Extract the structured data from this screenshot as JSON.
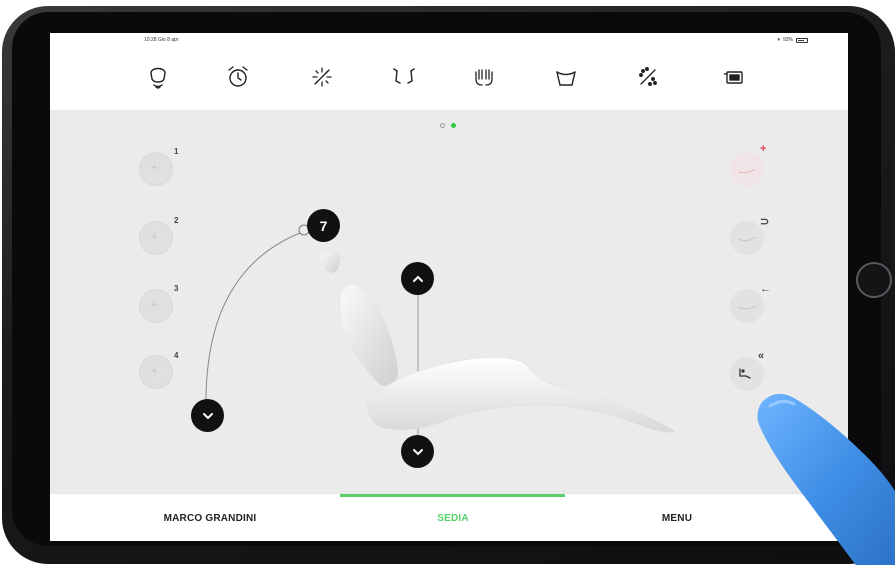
{
  "status_bar": {
    "time": "10:28 Gio 8 apr",
    "battery": "93%"
  },
  "toolbar": {
    "icons": [
      "spittoon-icon",
      "timer-icon",
      "operating-light-icon",
      "headrest-icon",
      "hands-icon",
      "basin-icon",
      "spray-icon",
      "monitor-icon"
    ]
  },
  "pager": {
    "total": 2,
    "active": 2
  },
  "memory_positions": [
    {
      "label": "1"
    },
    {
      "label": "2"
    },
    {
      "label": "3"
    },
    {
      "label": "4"
    }
  ],
  "right_controls": [
    {
      "badge": "+",
      "badge_color": "#e0405a",
      "name": "add-position"
    },
    {
      "badge": "⊃",
      "name": "rinse-position"
    },
    {
      "badge": "←",
      "name": "return-position"
    },
    {
      "badge": "«",
      "name": "exit-position"
    }
  ],
  "backrest_control": {
    "value": "7"
  },
  "tabs": [
    {
      "label": "MARCO GRANDINI",
      "color": "#222222"
    },
    {
      "label": "SEDIA",
      "color": "#58d16b",
      "active": true
    },
    {
      "label": "MENU",
      "color": "#222222"
    }
  ],
  "colors": {
    "accent": "#58d16b",
    "dark": "#111111",
    "background": "#ebebeb"
  }
}
